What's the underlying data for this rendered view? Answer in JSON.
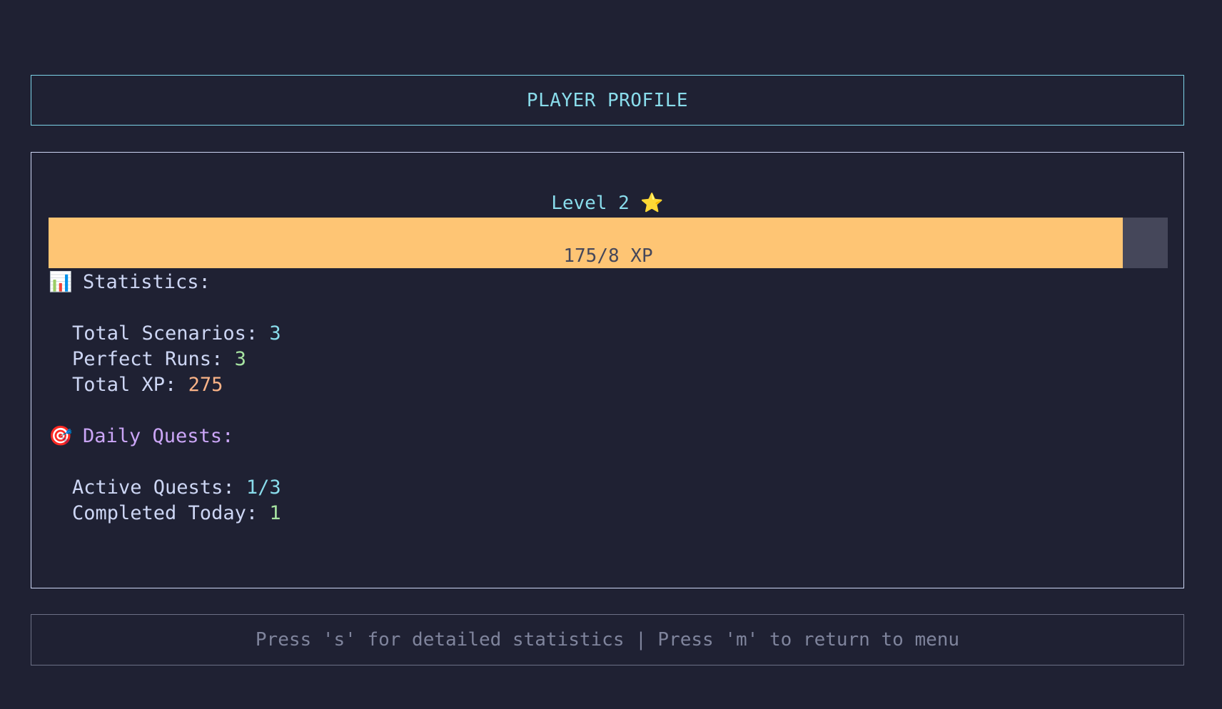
{
  "header": {
    "title": "PLAYER PROFILE"
  },
  "level": {
    "label": "Level 2",
    "icon": "star-icon",
    "icon_glyph": "⭐"
  },
  "xp": {
    "text": "175/8 XP",
    "progress_percent": 96,
    "fill_color": "#fec574",
    "track_color": "#45475a"
  },
  "statistics": {
    "icon": "bar-chart-icon",
    "icon_glyph": "📊",
    "heading": "Statistics:",
    "total_scenarios_label": "Total Scenarios: ",
    "total_scenarios_value": "3",
    "perfect_runs_label": "Perfect Runs: ",
    "perfect_runs_value": "3",
    "total_xp_label": "Total XP: ",
    "total_xp_value": "275"
  },
  "daily_quests": {
    "icon": "target-icon",
    "icon_glyph": "🎯",
    "heading": "Daily Quests:",
    "active_label": "Active Quests: ",
    "active_value": "1/3",
    "completed_label": "Completed Today: ",
    "completed_value": "1"
  },
  "footer": {
    "hint": "Press 's' for detailed statistics | Press 'm' to return to menu"
  },
  "colors": {
    "background": "#1f2133",
    "accent_cyan": "#89dceb",
    "accent_purple": "#cba6f7",
    "accent_green": "#a6e3a1",
    "accent_orange": "#fab387"
  }
}
